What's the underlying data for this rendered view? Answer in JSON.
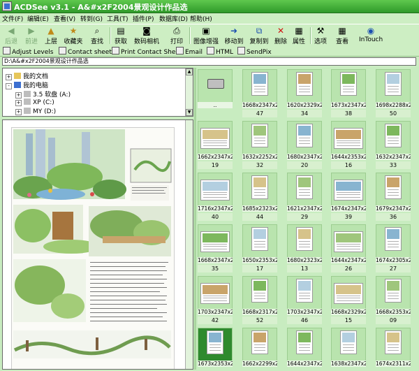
{
  "window": {
    "title": "ACDSee v3.1 - A&#x2F2004景观设计作品选"
  },
  "menu": [
    "文件(F)",
    "编辑(E)",
    "查看(V)",
    "转到(G)",
    "工具(T)",
    "插件(P)",
    "数据库(D)",
    "帮助(H)"
  ],
  "toolbar": {
    "back": "后退",
    "forward": "前进",
    "up": "上层",
    "favorites": "收藏夹",
    "find": "查找",
    "acquire": "获取",
    "camera": "数码相机",
    "print": "打印",
    "enhance": "图像增强",
    "move": "移动到",
    "copy": "复制到",
    "delete": "删除",
    "properties": "属性",
    "options": "选项",
    "view": "查看",
    "intouch": "InTouch"
  },
  "toolbar2": {
    "adjust": "Adjust Levels",
    "contact": "Contact sheet",
    "print_contact": "Print Contact Sheet",
    "email": "Email",
    "html": "HTML",
    "sendpix": "SendPix"
  },
  "address": "D:\\A&#x2F2004景观设计作品选",
  "tree": [
    {
      "label": "我的文档",
      "indent": 0,
      "expander": "+"
    },
    {
      "label": "我的电脑",
      "indent": 0,
      "expander": "-"
    },
    {
      "label": "3.5 软盘 (A:)",
      "indent": 1,
      "expander": "+"
    },
    {
      "label": "XP (C:)",
      "indent": 1,
      "expander": "+"
    },
    {
      "label": "MY (D:)",
      "indent": 1,
      "expander": "+"
    }
  ],
  "thumbs": [
    {
      "cap": "..",
      "num": ""
    },
    {
      "cap": "1668x2347x2...",
      "num": "47"
    },
    {
      "cap": "1620x2329x2...",
      "num": "34"
    },
    {
      "cap": "1673x2347x2...",
      "num": "38"
    },
    {
      "cap": "1698x2288x2...",
      "num": "50"
    },
    {
      "cap": "1662x2347x2...",
      "num": "19"
    },
    {
      "cap": "1632x2252x2...",
      "num": "32"
    },
    {
      "cap": "1680x2347x2...",
      "num": "20"
    },
    {
      "cap": "1644x2353x2...",
      "num": "16"
    },
    {
      "cap": "1632x2347x2...",
      "num": "33"
    },
    {
      "cap": "1716x2347x2...",
      "num": "40"
    },
    {
      "cap": "1685x2323x2...",
      "num": "44"
    },
    {
      "cap": "1621x2347x2...",
      "num": "29"
    },
    {
      "cap": "1674x2347x2...",
      "num": "39"
    },
    {
      "cap": "1679x2347x2...",
      "num": "36"
    },
    {
      "cap": "1668x2347x2...",
      "num": "35"
    },
    {
      "cap": "1650x2353x2...",
      "num": "17"
    },
    {
      "cap": "1680x2323x2...",
      "num": "13"
    },
    {
      "cap": "1644x2347x2...",
      "num": "26"
    },
    {
      "cap": "1674x2305x2...",
      "num": "27"
    },
    {
      "cap": "1703x2347x2...",
      "num": "42"
    },
    {
      "cap": "1668x2317x2...",
      "num": "52"
    },
    {
      "cap": "1703x2347x2...",
      "num": "46"
    },
    {
      "cap": "1668x2329x2...",
      "num": "15"
    },
    {
      "cap": "1668x2353x2...",
      "num": "09"
    },
    {
      "cap": "1673x2353x2...",
      "num": ""
    },
    {
      "cap": "1662x2299x2...",
      "num": ""
    },
    {
      "cap": "1644x2347x2...",
      "num": ""
    },
    {
      "cap": "1638x2347x2...",
      "num": ""
    },
    {
      "cap": "1674x2311x2...",
      "num": ""
    }
  ]
}
